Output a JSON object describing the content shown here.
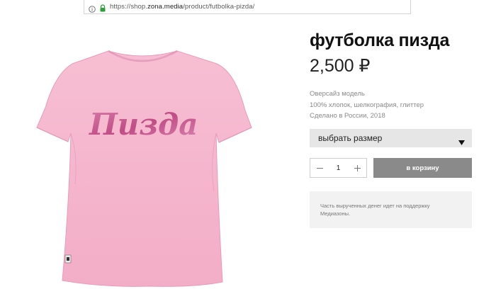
{
  "browser": {
    "url_prefix": "https://shop.",
    "url_host": "zona.media",
    "url_path": "/product/futbolka-pizda/"
  },
  "product": {
    "title": "футболка пизда",
    "price": "2,500 ₽",
    "details": [
      "Оверсайз модель",
      "100% хлопок, шелкография, глиттер",
      "Сделано в России, 2018"
    ],
    "image_text": "Пизда",
    "image_colors": {
      "shirt": "#f6b8cf",
      "print": "#cc5c92"
    }
  },
  "size_select": {
    "label": "выбрать размер"
  },
  "quantity": {
    "value": "1"
  },
  "cart": {
    "label": "в корзину",
    "color": "#8a8a8a"
  },
  "note": {
    "line1": "Часть вырученных денег идет на поддержку",
    "line2": "Медиазоны."
  }
}
